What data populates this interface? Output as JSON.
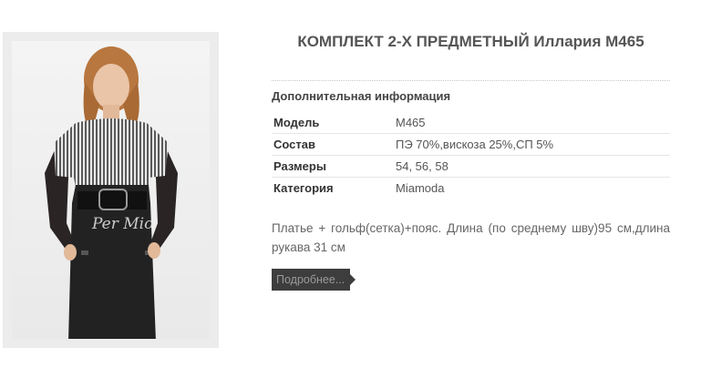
{
  "product": {
    "title": "КОМПЛЕКТ 2-Х ПРЕДМЕТНЫЙ Иллария М465",
    "image_alt": "Фото модели в комплекте: серо-белый полосатый топ, черное платье с сетчатыми рукавами и поясом",
    "watermark": "Per Mio"
  },
  "info": {
    "heading": "Дополнительная информация",
    "rows": [
      {
        "key": "Модель",
        "value": "М465"
      },
      {
        "key": "Состав",
        "value": "ПЭ 70%,вискоза 25%,СП 5%"
      },
      {
        "key": "Размеры",
        "value": "54, 56, 58"
      },
      {
        "key": "Категория",
        "value": "Miamoda"
      }
    ]
  },
  "description": "Платье + гольф(сетка)+пояс. Длина (по среднему шву)95 см,длина рукава 31 см",
  "more_button": {
    "label": "Подробнее..."
  },
  "colors": {
    "button_bg": "#3d3d3d",
    "button_text": "#9a9a9a",
    "frame_bg": "#ececec"
  }
}
